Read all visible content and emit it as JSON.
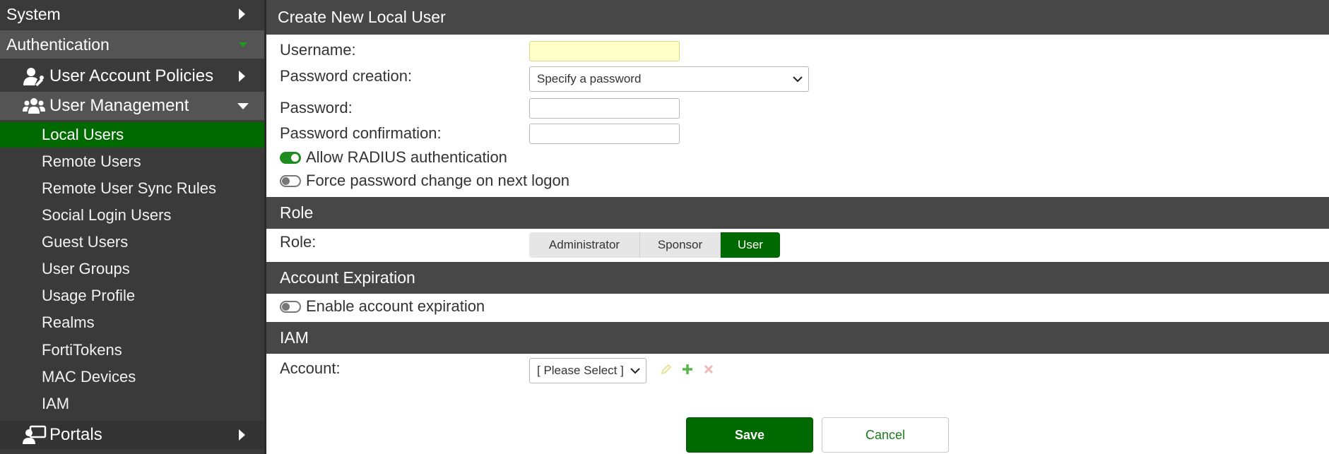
{
  "sidebar": {
    "system": "System",
    "authentication": "Authentication",
    "user_account_policies": "User Account Policies",
    "user_management": "User Management",
    "items": [
      "Local Users",
      "Remote Users",
      "Remote User Sync Rules",
      "Social Login Users",
      "Guest Users",
      "User Groups",
      "Usage Profile",
      "Realms",
      "FortiTokens",
      "MAC Devices",
      "IAM"
    ],
    "active_item": "Local Users",
    "portals": "Portals"
  },
  "form": {
    "title": "Create New Local User",
    "username_label": "Username:",
    "username_value": "",
    "password_creation_label": "Password creation:",
    "password_creation_value": "Specify a password",
    "password_label": "Password:",
    "password_value": "",
    "password_confirm_label": "Password confirmation:",
    "password_confirm_value": "",
    "allow_radius_label": "Allow RADIUS authentication",
    "allow_radius_on": true,
    "force_password_label": "Force password change on next logon",
    "force_password_on": false
  },
  "role": {
    "header": "Role",
    "label": "Role:",
    "options": [
      "Administrator",
      "Sponsor",
      "User"
    ],
    "selected": "User"
  },
  "expiration": {
    "header": "Account Expiration",
    "enable_label": "Enable account expiration",
    "enable_on": false
  },
  "iam": {
    "header": "IAM",
    "account_label": "Account:",
    "account_value": "[ Please Select ]"
  },
  "actions": {
    "save": "Save",
    "cancel": "Cancel"
  },
  "colors": {
    "accent_green": "#006a00",
    "header_gray": "#474747",
    "sidebar_bg": "#3a3a3a",
    "input_highlight": "#ffffc8"
  },
  "icons": {
    "nav_collapsed": "caret-right-icon",
    "nav_expanded": "caret-down-icon",
    "user_account_policies": "user-gear-icon",
    "user_management": "users-icon",
    "portals": "portal-icon",
    "edit": "pencil-icon",
    "add": "plus-icon",
    "remove": "x-icon"
  }
}
